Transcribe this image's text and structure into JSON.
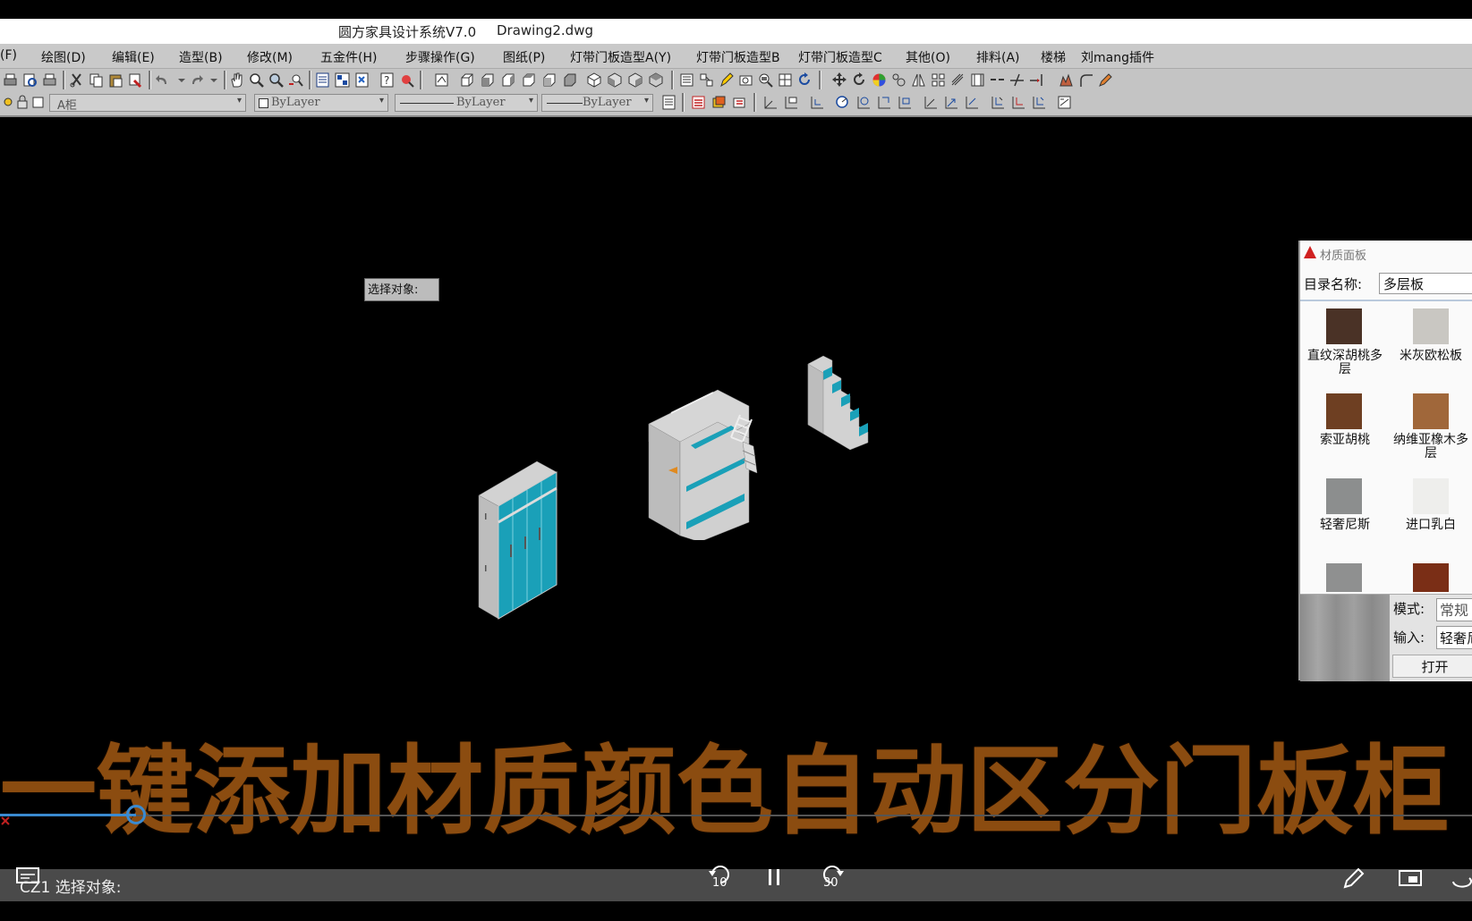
{
  "window": {
    "app_title": "圆方家具设计系统V7.0",
    "document": "Drawing2.dwg"
  },
  "menu": [
    "(F)",
    "绘图(D)",
    "编辑(E)",
    "造型(B)",
    "修改(M)",
    "五金件(H)",
    "步骤操作(G)",
    "图纸(P)",
    "灯带门板造型A(Y)",
    "灯带门板造型B",
    "灯带门板造型C",
    "其他(O)",
    "排料(A)",
    "楼梯",
    "刘mang插件"
  ],
  "layer_bar": {
    "layer": "A柜",
    "color": "ByLayer",
    "linetype": "ByLayer",
    "lineweight": "ByLayer"
  },
  "canvas": {
    "prompt_tip": "选择对象:"
  },
  "material_panel": {
    "title": "材质面板",
    "catalog_label": "目录名称:",
    "catalog_value": "多层板",
    "materials": [
      {
        "name": "直纹深胡桃多层",
        "color": "#4a3226"
      },
      {
        "name": "米灰欧松板",
        "color": "#c9c7c2"
      },
      {
        "name": "索亚胡桃",
        "color": "#6e3f22"
      },
      {
        "name": "纳维亚橡木多层",
        "color": "#a0673a"
      },
      {
        "name": "轻奢尼斯",
        "color": "#8c8e8e"
      },
      {
        "name": "进口乳白",
        "color": "#eeeeec"
      },
      {
        "name": "",
        "color": "#8f9090"
      },
      {
        "name": "",
        "color": "#7a2e16"
      }
    ],
    "mode_label": "模式:",
    "mode_value": "常规",
    "input_label": "输入:",
    "input_value": "轻奢尼斯",
    "open_button": "打开"
  },
  "caption": "一键添加材质颜色自动区分门板柜",
  "command_line": {
    "text": "CZ1 选择对象:"
  },
  "player": {
    "rewind": "10",
    "forward": "30"
  },
  "colors": {
    "accent_teal": "#1aa0b8",
    "furniture_grey": "#c8c8c8",
    "caption": "#8b4c10",
    "progress": "#3a8ad0"
  }
}
